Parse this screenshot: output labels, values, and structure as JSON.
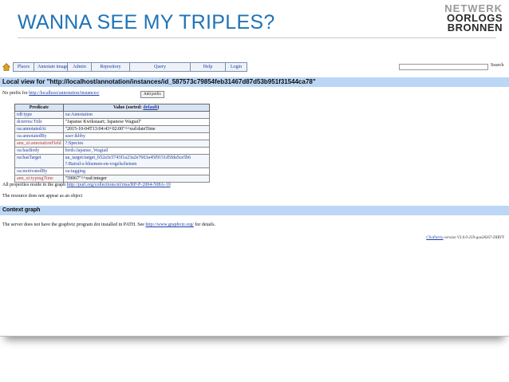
{
  "slide": {
    "title": "WANNA SEE MY TRIPLES?",
    "logo": [
      "NETWERK",
      "OORLOGS",
      "BRONNEN"
    ]
  },
  "nav": {
    "items": [
      "Places",
      "Annotate image",
      "Admin",
      "Repository",
      "Query",
      "Help",
      "Login"
    ]
  },
  "search": {
    "button_label": "Search"
  },
  "local_view": {
    "heading": "Local view for \"http://localhost/annotation/instances/id_587573c79854feb31467d87d53b951f31544ca78\"",
    "prefix_text": "No prefix for ",
    "prefix_link": "http://localhost/annotation/instances/",
    "add_prefix_label": "Add prefix"
  },
  "table": {
    "header_predicate": "Predicate",
    "header_value_prefix": "Value (sorted: ",
    "header_value_link": "default",
    "header_value_suffix": ")",
    "rows": [
      {
        "pred": "rdf:type",
        "value": "oa:Annotation",
        "value2": "",
        "red": false,
        "link": true
      },
      {
        "pred": "dcterms:Title",
        "value": "\"Japanse Kwikstaart; Japanese Wagtail\"",
        "value2": "",
        "red": false,
        "link": false
      },
      {
        "pred": "oa:annotatedAt",
        "value": "\"2015-10-04T13:04:43+02:00\"^^xsd:dateTime",
        "value2": "",
        "red": false,
        "link": false
      },
      {
        "pred": "oa:annotatedBy",
        "value": "user:ikbby",
        "value2": "",
        "red": false,
        "link": true
      },
      {
        "pred": "ann_ui:annotationField",
        "value": "?:Species",
        "value2": "",
        "red": true,
        "link": true
      },
      {
        "pred": "oa:hasBody",
        "value": "birds:Japanse_Wagtail",
        "value2": "",
        "red": false,
        "link": true
      },
      {
        "pred": "oa:hasTarget",
        "value": "ua_target:target_b52a3c5743f1a23a2e7663a45f9151d5fda5ce5b6",
        "value2": "?:Bairul-s-bloemen-en-vogelschetsen",
        "red": false,
        "link": true
      },
      {
        "pred": "oa:motivatedBy",
        "value": "oa:tagging",
        "value2": "",
        "red": false,
        "link": true
      },
      {
        "pred": "ann_ui:typingTime",
        "value": "\"59067\"^^xsd:integer",
        "value2": "",
        "red": true,
        "link": false
      }
    ]
  },
  "graph_info": {
    "text": "All properties reside in the graph ",
    "link": "http://purl.org/collections/nl/rma/RP-P-2004-508A-10"
  },
  "object_info": {
    "text": "The resource does not appear as an object"
  },
  "context_graph": {
    "heading": "Context graph",
    "text_prefix": "The server does not have the graphviz program dot installed in PATH. See ",
    "link": "http://www.graphviz.org/",
    "text_suffix": " for details."
  },
  "footer": {
    "link": "ClioPatria",
    "text": " version V3.0.0-259-gae28267-DIRTY"
  }
}
